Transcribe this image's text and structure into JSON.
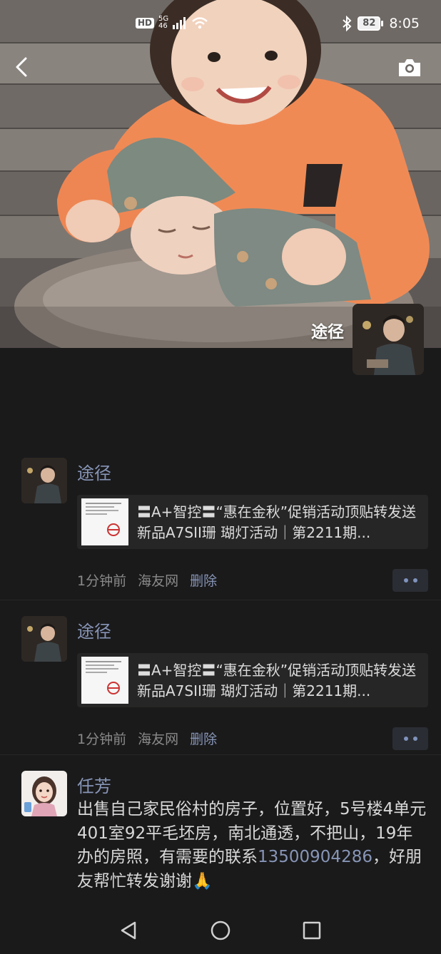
{
  "status_bar": {
    "hd": "HD",
    "network": "5G",
    "network_sub": "46",
    "battery": "82",
    "time": "8:05",
    "icons": [
      "signal-icon",
      "wifi-icon",
      "bluetooth-icon",
      "battery-icon"
    ]
  },
  "header": {
    "back_icon": "chevron-left-icon",
    "camera_icon": "camera-icon",
    "owner_name": "途径"
  },
  "posts": [
    {
      "author": "途径",
      "link_title": "〓A+智控〓“惠在金秋”促销活动顶贴转发送新品A7SII珊 瑚灯活动｜第2211期...",
      "time": "1分钟前",
      "source": "海友网",
      "delete_label": "删除"
    },
    {
      "author": "途径",
      "link_title": "〓A+智控〓“惠在金秋”促销活动顶贴转发送新品A7SII珊 瑚灯活动｜第2211期...",
      "time": "1分钟前",
      "source": "海友网",
      "delete_label": "删除"
    },
    {
      "author": "任芳",
      "text_before": "出售自己家民俗村的房子，位置好，5号楼4单元401室92平毛坯房，南北通透，不把山，19年办的房照，有需要的联系",
      "phone": "13500904286",
      "text_after": "，好朋友帮忙转发谢谢🙏"
    }
  ],
  "nav": {
    "icons": [
      "back-triangle-icon",
      "home-circle-icon",
      "recents-square-icon"
    ]
  },
  "colors": {
    "background": "#1a1a1b",
    "card": "#262626",
    "name_link": "#8795b6",
    "meta": "#8a8a8a"
  }
}
